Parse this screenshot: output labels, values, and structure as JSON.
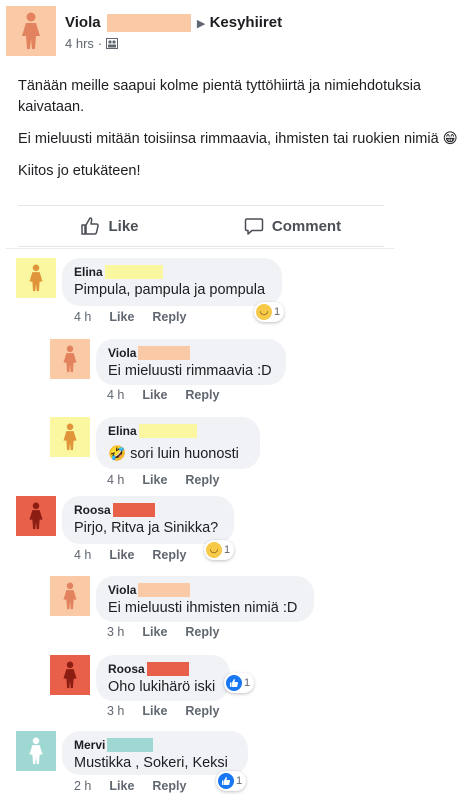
{
  "post": {
    "author": "Viola",
    "group": "Kesyhiiret",
    "time": "4 hrs",
    "paragraphs": [
      "Tänään meille saapui kolme pientä tyttöhiirtä ja nimiehdotuksia kaivataan.",
      "Ei mieluusti mitään toisiinsa rimmaavia, ihmisten tai ruokien nimiä 😁",
      "Kiitos jo etukäteen!"
    ]
  },
  "actions": {
    "like": "Like",
    "comment": "Comment"
  },
  "comments": [
    {
      "name": "Elina",
      "text": "Pimpula, pampula ja pompula",
      "time": "4 h",
      "like": "Like",
      "reply": "Reply",
      "reaction_count": "1",
      "color": "#fbf6a0",
      "redact": "#fbf6a0",
      "person": "#e0953a"
    },
    {
      "name": "Viola",
      "text": "Ei mieluusti rimmaavia :D",
      "time": "4 h",
      "like": "Like",
      "reply": "Reply",
      "color": "#f9caa5",
      "redact": "#f9caa5",
      "person": "#e3825e"
    },
    {
      "name": "Elina",
      "text": "🤣 sori luin huonosti",
      "time": "4 h",
      "like": "Like",
      "reply": "Reply",
      "color": "#fbf6a0",
      "redact": "#fbf6a0",
      "person": "#e0953a"
    },
    {
      "name": "Roosa",
      "text": "Pirjo, Ritva ja Sinikka?",
      "time": "4 h",
      "like": "Like",
      "reply": "Reply",
      "reaction_count": "1",
      "color": "#e8604a",
      "redact": "#e8604a",
      "person": "#8b1d12"
    },
    {
      "name": "Viola",
      "text": "Ei mieluusti ihmisten nimiä :D",
      "time": "3 h",
      "like": "Like",
      "reply": "Reply",
      "color": "#f9caa5",
      "redact": "#f9caa5",
      "person": "#e3825e"
    },
    {
      "name": "Roosa",
      "text": "Oho lukihärö iski",
      "time": "3 h",
      "like": "Like",
      "reply": "Reply",
      "reaction_count": "1",
      "color": "#e8604a",
      "redact": "#e8604a",
      "person": "#8b1d12"
    },
    {
      "name": "Mervi",
      "text": "Mustikka , Sokeri, Keksi",
      "time": "2 h",
      "like": "Like",
      "reply": "Reply",
      "reaction_count": "1",
      "color": "#9fd8d3",
      "redact": "#9fd8d3",
      "person": "#ffffff"
    }
  ],
  "icons": {
    "separator": "triangle-right-icon",
    "audience": "group-icon",
    "like": "thumbs-up-icon",
    "comment": "speech-bubble-icon"
  }
}
